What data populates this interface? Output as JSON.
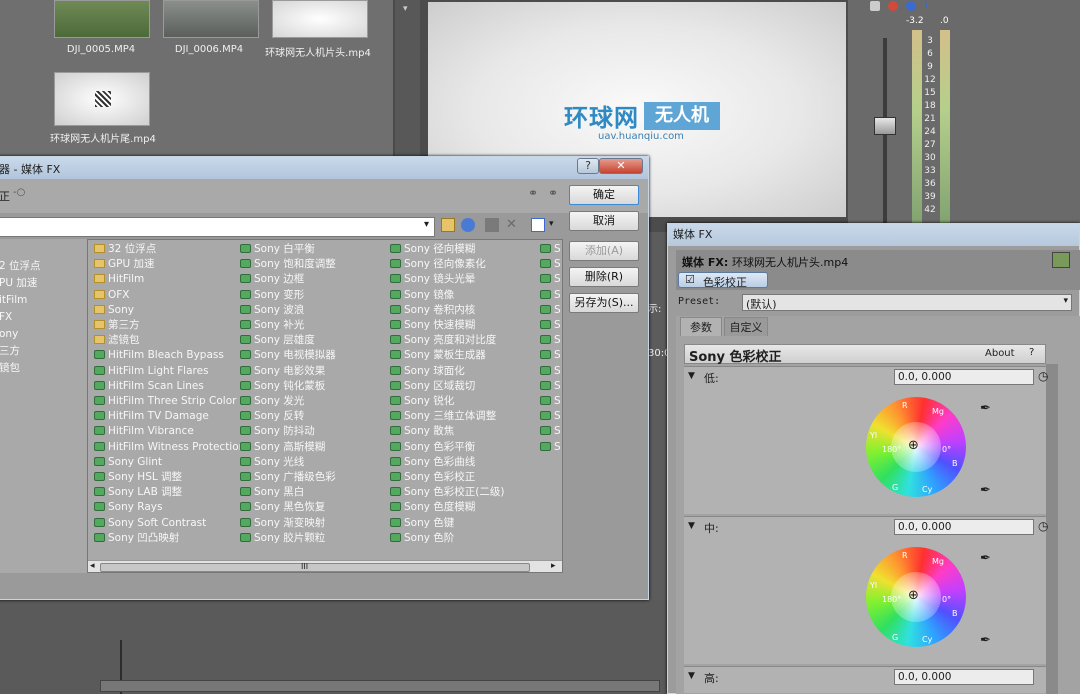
{
  "media_bin": {
    "clips": [
      "DJI_0005.MP4",
      "DJI_0006.MP4",
      "环球网无人机片头.mp4",
      "环球网无人机片尾.mp4"
    ]
  },
  "preview": {
    "logo_main": "环球网",
    "logo_box": "无人机",
    "logo_url": "uav.huanqiu.com"
  },
  "meter": {
    "top_left": "-3.2",
    "top_right": ".0",
    "ticks": [
      "3",
      "6",
      "9",
      "12",
      "15",
      "18",
      "21",
      "24",
      "27",
      "30",
      "33",
      "36",
      "39",
      "42"
    ]
  },
  "chooser": {
    "title": "器 - 媒体 FX",
    "toolbar_label": "正",
    "help_label": "?",
    "close_label": "✕",
    "tree": [
      "2 位浮点",
      "PU 加速",
      "itFilm",
      "FX",
      "ony",
      "三方",
      "镜包"
    ],
    "columns": [
      [
        "32 位浮点",
        "GPU 加速",
        "HitFilm",
        "OFX",
        "Sony",
        "第三方",
        "滤镜包",
        "HitFilm Bleach Bypass",
        "HitFilm Light Flares",
        "HitFilm Scan Lines",
        "HitFilm Three Strip Color",
        "HitFilm TV Damage",
        "HitFilm Vibrance",
        "HitFilm Witness Protection",
        "Sony Glint",
        "Sony HSL 调整",
        "Sony LAB 调整",
        "Sony Rays",
        "Sony Soft Contrast",
        "Sony 凹凸映射"
      ],
      [
        "Sony 白平衡",
        "Sony 饱和度调整",
        "Sony 边框",
        "Sony 变形",
        "Sony 波浪",
        "Sony 补光",
        "Sony 层雄度",
        "Sony 电视模拟器",
        "Sony 电影效果",
        "Sony 钝化蒙板",
        "Sony 发光",
        "Sony 反转",
        "Sony 防抖动",
        "Sony 高斯模糊",
        "Sony 光线",
        "Sony 广播级色彩",
        "Sony 黑白",
        "Sony 黑色恢复",
        "Sony 渐变映射",
        "Sony 胶片颗粒"
      ],
      [
        "Sony 径向模糊",
        "Sony 径向像素化",
        "Sony 镜头光晕",
        "Sony 镜像",
        "Sony 卷积内核",
        "Sony 快速模糊",
        "Sony 亮度和对比度",
        "Sony 蒙板生成器",
        "Sony 球面化",
        "Sony 区域裁切",
        "Sony 锐化",
        "Sony 三维立体调整",
        "Sony 散焦",
        "Sony 色彩平衡",
        "Sony 色彩曲线",
        "Sony 色彩校正",
        "Sony 色彩校正(二级)",
        "Sony 色度模糊",
        "Sony 色键",
        "Sony 色阶"
      ],
      [
        "S",
        "S",
        "S",
        "S",
        "S",
        "S",
        "S",
        "S",
        "S",
        "S",
        "S",
        "S",
        "S",
        "S"
      ]
    ],
    "scroll_grip": "III",
    "buttons": {
      "ok": "确定",
      "cancel": "取消",
      "add": "添加(A)",
      "remove": "删除(R)",
      "save_as": "另存为(S)..."
    }
  },
  "timeline": {
    "partial_label_1": "示:",
    "partial_label_2": "30:0"
  },
  "mediafx": {
    "title": "媒体 FX",
    "header_label": "媒体 FX:",
    "header_file": "环球网无人机片头.mp4",
    "chain_item": "色彩校正",
    "preset_label": "Preset:",
    "preset_value": "(默认)",
    "tabs": [
      "参数",
      "自定义"
    ],
    "plugin_title": "Sony 色彩校正",
    "about_label": "About",
    "help_label": "?",
    "sections": [
      {
        "label": "低:",
        "value": "0.0, 0.000"
      },
      {
        "label": "中:",
        "value": "0.0, 0.000"
      },
      {
        "label": "高:",
        "value": "0.0, 0.000"
      }
    ],
    "wheel_labels": {
      "r": "R",
      "mg": "Mg",
      "b": "B",
      "cy": "Cy",
      "g": "G",
      "yl": "Yl",
      "deg180": "180°",
      "deg0": "0°"
    }
  }
}
